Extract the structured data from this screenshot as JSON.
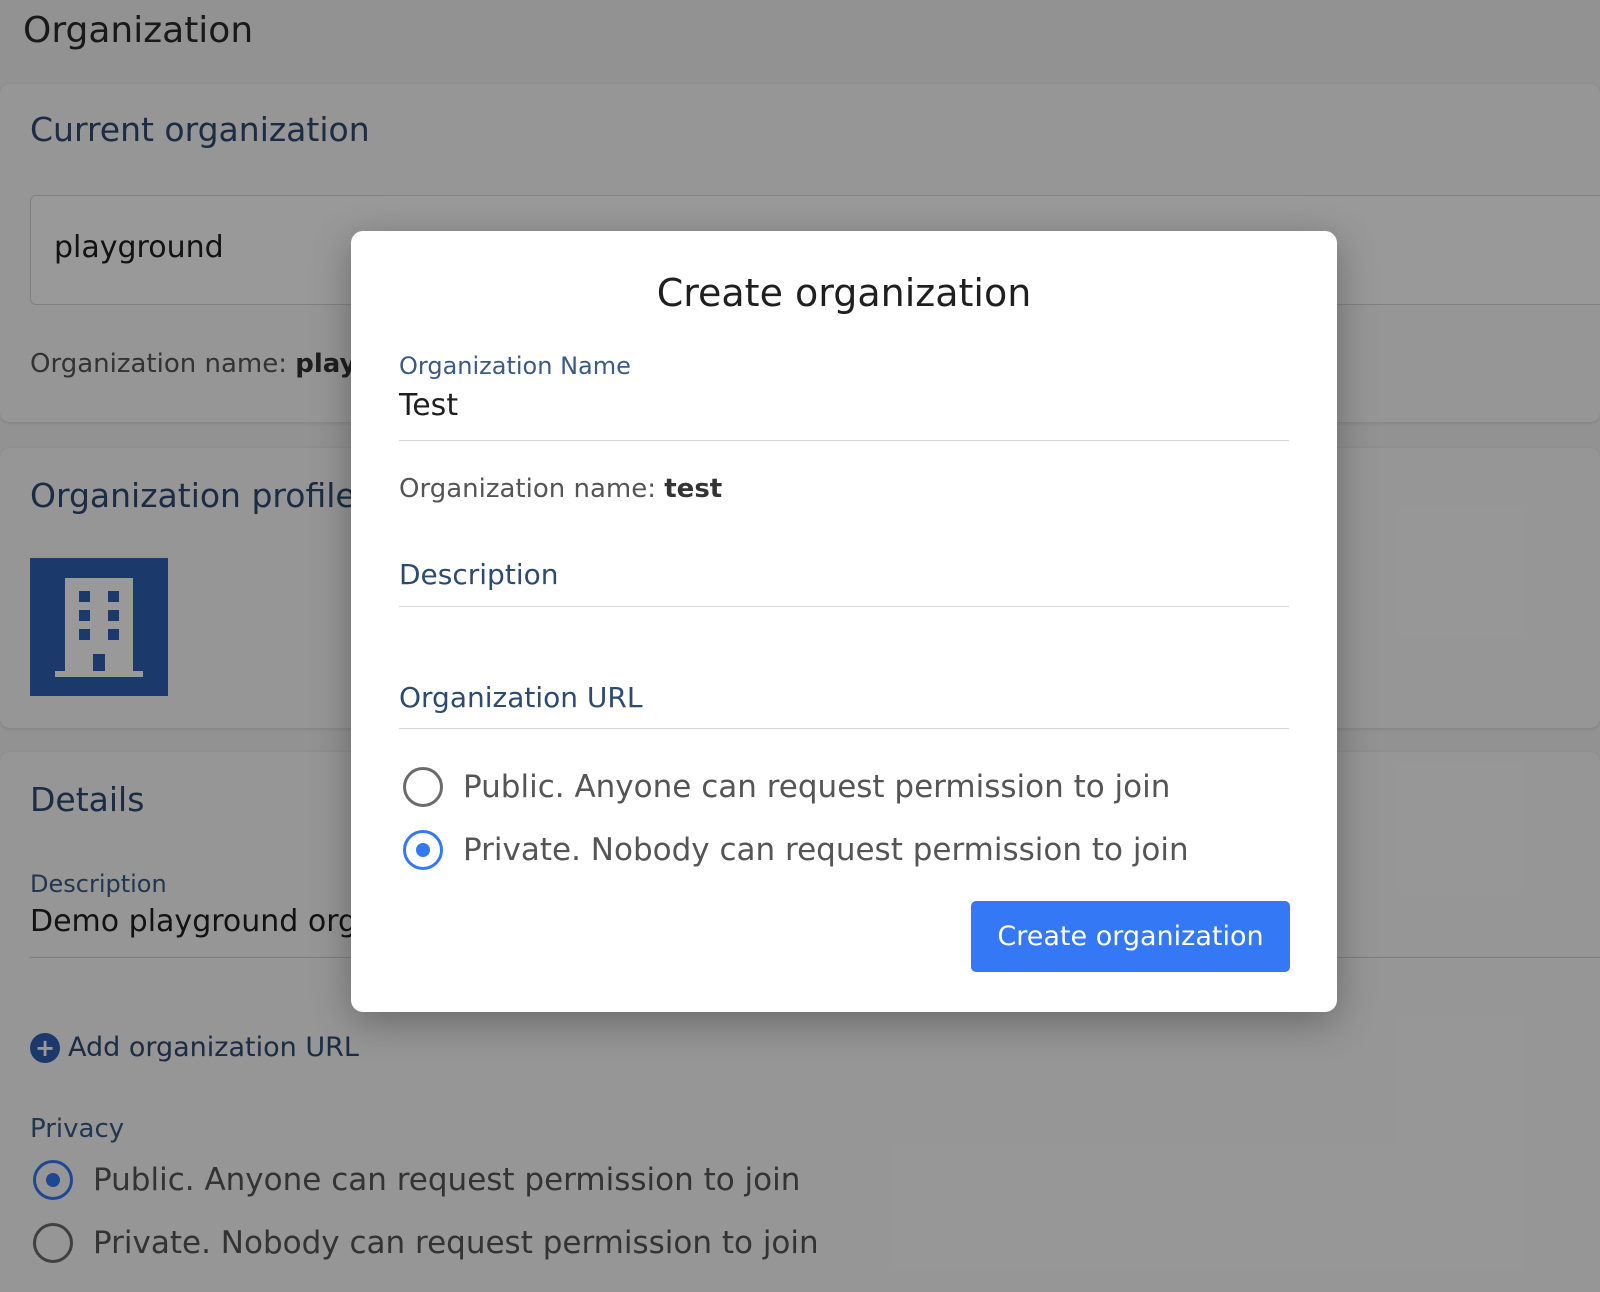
{
  "page": {
    "title": "Organization"
  },
  "current_org": {
    "heading": "Current organization",
    "selected": "playground",
    "name_hint_label": "Organization name:",
    "name_hint_value": "playground"
  },
  "profile": {
    "heading": "Organization profile"
  },
  "details": {
    "heading": "Details",
    "description_label": "Description",
    "description_value": "Demo playground organization",
    "add_url_label": "Add organization URL",
    "privacy_label": "Privacy",
    "privacy_options": [
      {
        "label": "Public. Anyone can request permission to join",
        "checked": true
      },
      {
        "label": "Private. Nobody can request permission to join",
        "checked": false
      }
    ]
  },
  "modal": {
    "title": "Create organization",
    "name_label": "Organization Name",
    "name_value": "Test",
    "name_hint_label": "Organization name:",
    "name_hint_value": "test",
    "description_label": "Description",
    "url_label": "Organization URL",
    "privacy_options": [
      {
        "label": "Public. Anyone can request permission to join",
        "checked": false
      },
      {
        "label": "Private. Nobody can request permission to join",
        "checked": true
      }
    ],
    "submit_label": "Create organization"
  },
  "colors": {
    "accent": "#3478f6",
    "heading": "#2d4a72",
    "avatar_bg": "#2f5fb3"
  },
  "icons": {
    "avatar": "building-icon",
    "add": "plus-circle-icon"
  }
}
